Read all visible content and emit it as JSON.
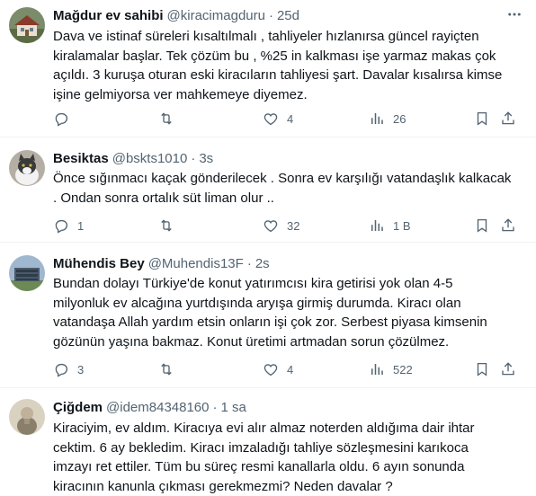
{
  "tweets": [
    {
      "name": "Mağdur ev sahibi",
      "handle": "@kiracimagduru",
      "sep": "·",
      "time": "25d",
      "text": "Dava ve istinaf süreleri kısaltılmalı , tahliyeler hızlanırsa güncel rayiçten\nkiralamalar başlar. Tek çözüm bu , %25 in kalkması işe yarmaz makas çok\naçıldı. 3 kuruşa oturan eski kiracıların tahliyesi şart. Davalar kısalırsa kimse\nişine gelmiyorsa ver mahkemeye diyemez.",
      "replies": "",
      "retweets": "",
      "likes": "4",
      "views": "26"
    },
    {
      "name": "Besiktas",
      "handle": "@bskts1010",
      "sep": "·",
      "time": "3s",
      "text": "Önce sığınmacı kaçak gönderilecek . Sonra ev karşılığı vatandaşlık kalkacak\n. Ondan sonra ortalık süt liman olur ..",
      "replies": "1",
      "retweets": "",
      "likes": "32",
      "views": "1 B"
    },
    {
      "name": "Mühendis Bey",
      "handle": "@Muhendis13F",
      "sep": "·",
      "time": "2s",
      "text": "Bundan dolayı Türkiye'de konut yatırımcısı kira getirisi yok olan 4-5\nmilyonluk ev alcağına yurtdışında aryışa girmiş durumda. Kiracı olan\nvatandaşa Allah yardım etsin onların işi çok zor. Serbest piyasa kimsenin\ngözünün yaşına bakmaz. Konut üretimi artmadan sorun çözülmez.",
      "replies": "3",
      "retweets": "",
      "likes": "4",
      "views": "522"
    },
    {
      "name": "Çiğdem",
      "handle": "@idem84348160",
      "sep": "·",
      "time": "1 sa",
      "text": "Kiraciyim, ev aldım. Kiracıya evi alır almaz noterden aldığıma dair ihtar\ncektim. 6 ay bekledim. Kiracı imzaladığı tahliye sözleşmesini karıkoca\nimzayı ret ettiler. Tüm bu süreç resmi kanallarla oldu. 6 ayın sonunda\nkiracının kanunla çıkması gerekmezmi? Neden davalar ?",
      "replies": "",
      "retweets": "",
      "likes": "",
      "views": ""
    }
  ],
  "icons": {
    "reply": "reply-icon",
    "retweet": "retweet-icon",
    "like": "like-icon",
    "views": "views-icon",
    "bookmark": "bookmark-icon",
    "share": "share-icon",
    "more": "more-icon"
  },
  "colors": {
    "text": "#0f1419",
    "secondary": "#536471",
    "divider": "#eff3f4"
  }
}
